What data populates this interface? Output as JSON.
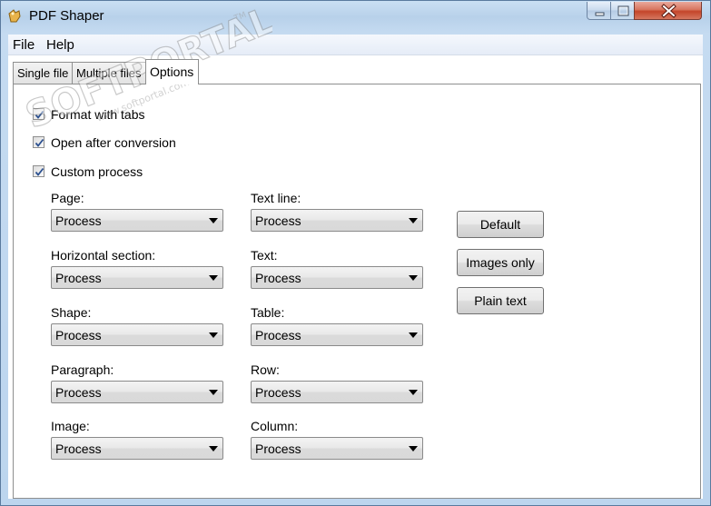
{
  "window": {
    "title": "PDF Shaper",
    "title_icon": "pdf-shaper-app-icon",
    "controls": [
      "minimize-icon",
      "maximize-icon",
      "close-icon"
    ]
  },
  "menubar": {
    "file_label": "File",
    "help_label": "Help"
  },
  "tabs": [
    {
      "label": "Single file",
      "selected": false
    },
    {
      "label": "Multiple files",
      "selected": false
    },
    {
      "label": "Options",
      "selected": true
    }
  ],
  "options": {
    "format_with_tabs": {
      "label": "Format with tabs",
      "checked": true
    },
    "open_after_conversion": {
      "label": "Open after conversion",
      "checked": true
    },
    "custom_process": {
      "label": "Custom process",
      "checked": true
    }
  },
  "fields": {
    "page": {
      "label": "Page:",
      "value": "Process"
    },
    "horizontal_section": {
      "label": "Horizontal section:",
      "value": "Process"
    },
    "shape": {
      "label": "Shape:",
      "value": "Process"
    },
    "paragraph": {
      "label": "Paragraph:",
      "value": "Process"
    },
    "image": {
      "label": "Image:",
      "value": "Process"
    },
    "text_line": {
      "label": "Text line:",
      "value": "Process"
    },
    "text": {
      "label": "Text:",
      "value": "Process"
    },
    "table": {
      "label": "Table:",
      "value": "Process"
    },
    "row": {
      "label": "Row:",
      "value": "Process"
    },
    "column": {
      "label": "Column:",
      "value": "Process"
    }
  },
  "buttons": {
    "default_label": "Default",
    "images_only_label": "Images only",
    "plain_text_label": "Plain text"
  },
  "watermark": {
    "text": "SOFTPORTAL",
    "url": "www.softportal.com",
    "tm": "TM"
  },
  "colors": {
    "titlebar": "#bcd5ee",
    "close_button": "#c4452a",
    "check_mark": "#2a4f8f"
  }
}
